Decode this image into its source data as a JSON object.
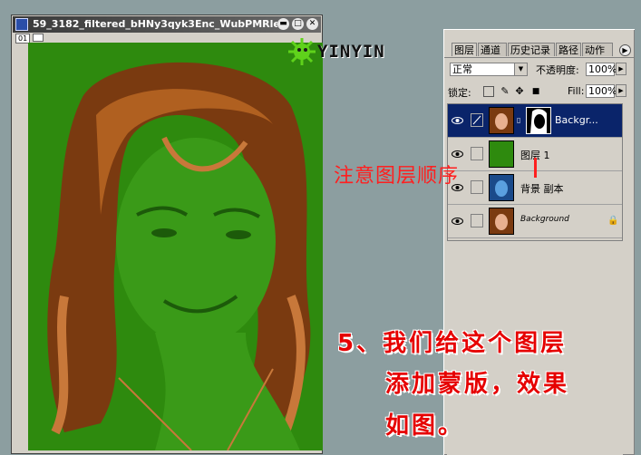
{
  "document": {
    "title": "59_3182_filtered_bHNy3qyk3Enc_WubPMRle...",
    "zoom_badge": "01",
    "canvas_bg": "#2e8a0e"
  },
  "logo": {
    "text": "YINYIN"
  },
  "layers_panel": {
    "tabs": [
      "图层",
      "通道",
      "历史记录",
      "路径",
      "动作"
    ],
    "blend_mode": "正常",
    "opacity_label": "不透明度:",
    "opacity_value": "100%",
    "lock_label": "锁定:",
    "fill_label": "Fill:",
    "fill_value": "100%",
    "layers": [
      {
        "name": "Backgr...",
        "selected": true,
        "has_mask": true
      },
      {
        "name": "图层 1",
        "selected": false,
        "has_mask": false
      },
      {
        "name": "背景 副本",
        "selected": false,
        "has_mask": false
      },
      {
        "name": "Background",
        "selected": false,
        "has_mask": false,
        "locked": true
      }
    ],
    "colors": {
      "selected_row": "#0a246a",
      "green_layer": "#2e8a0e"
    }
  },
  "annotations": {
    "note": "注意图层顺序",
    "step_lines": [
      "5、我们给这个图层",
      "添加蒙版，效果",
      "如图。"
    ],
    "note_color": "#ff1f1f",
    "step_color": "#e60000"
  }
}
